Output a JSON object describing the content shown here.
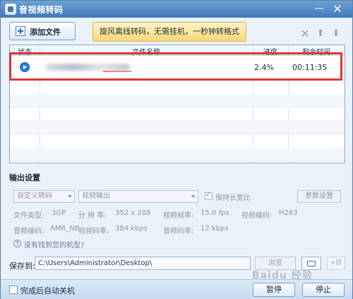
{
  "window": {
    "title": "音视频转码",
    "minimize_label": "—",
    "close_label": "✕"
  },
  "toolbar": {
    "add_file_label": "添加文件",
    "promo_text": "旋风离线转码，无需挂机，一秒钟转格式",
    "delete_icon": "✕",
    "move_up_icon": "⬆",
    "move_down_icon": "⬇"
  },
  "table": {
    "columns": {
      "status": "状态",
      "name": "文件名称",
      "progress": "进度",
      "remaining": "剩余时间"
    },
    "rows": [
      {
        "status_icon": "play-arrow-icon",
        "name": "",
        "progress": "2.4%",
        "remaining": "00:11:35"
      }
    ],
    "highlight_color": "#e03434"
  },
  "output": {
    "section_title": "输出设置",
    "preset": "自定义转码",
    "video_output": "视频输出",
    "keep_ratio_label": "保持长宽比",
    "keep_ratio_checked": true,
    "param_button": "参数设置",
    "info": {
      "file_type_label": "文件类型:",
      "file_type_value": "3GP",
      "resolution_label": "分 辨 率:",
      "resolution_value": "352 x 288",
      "frame_rate_label": "视频帧率:",
      "frame_rate_value": "15.0 fps",
      "video_codec_label": "视频编码:",
      "video_codec_value": "H263",
      "audio_codec_label": "音频编码:",
      "audio_codec_value": "AMR_NB",
      "video_bitrate_label": "视频码率:",
      "video_bitrate_value": "384 kbps",
      "audio_bitrate_label": "音频码率:",
      "audio_bitrate_value": "12 kbps"
    },
    "help_text": "没有找到您的机型?"
  },
  "save": {
    "label": "保存到:",
    "path": "C:\\Users\\Administrator\\Desktop\\",
    "browse_label": "浏览",
    "extra_label": "+目"
  },
  "footer": {
    "auto_shutdown_label": "完成后自动关机",
    "pause_label": "暂停",
    "stop_label": "停止"
  },
  "watermark": "Baidu 经验"
}
